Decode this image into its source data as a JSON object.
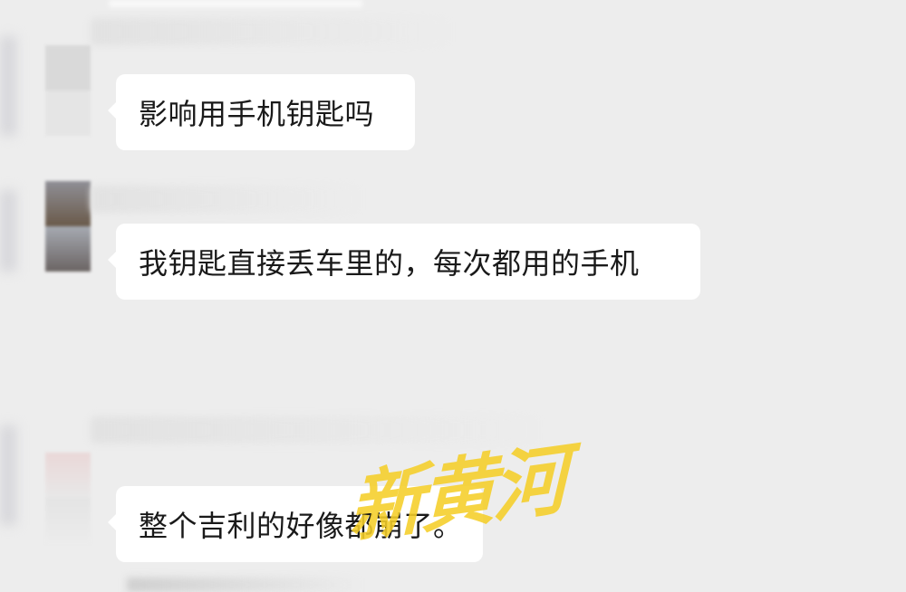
{
  "messages": [
    {
      "text": "影响用手机钥匙吗",
      "avatar_colors": [
        "#d9d9d9",
        "#d9d9d9",
        "#e5e5e5",
        "#e5e5e5"
      ]
    },
    {
      "text": "我钥匙直接丢车里的，每次都用的手机",
      "avatar_colors": [
        "#8f8f96",
        "#6a5a4a",
        "#a6aab2",
        "#6b6463"
      ]
    },
    {
      "text": "整个吉利的好像都崩了。",
      "avatar_colors": [
        "#ead8d8",
        "#e8e8e8",
        "#e4e4e4",
        "#ececec"
      ]
    }
  ],
  "watermark": {
    "text": "新黄河",
    "color": "#f5ce28"
  },
  "colors": {
    "background": "#ededed",
    "bubble": "#ffffff",
    "text": "#1a1a1a"
  }
}
